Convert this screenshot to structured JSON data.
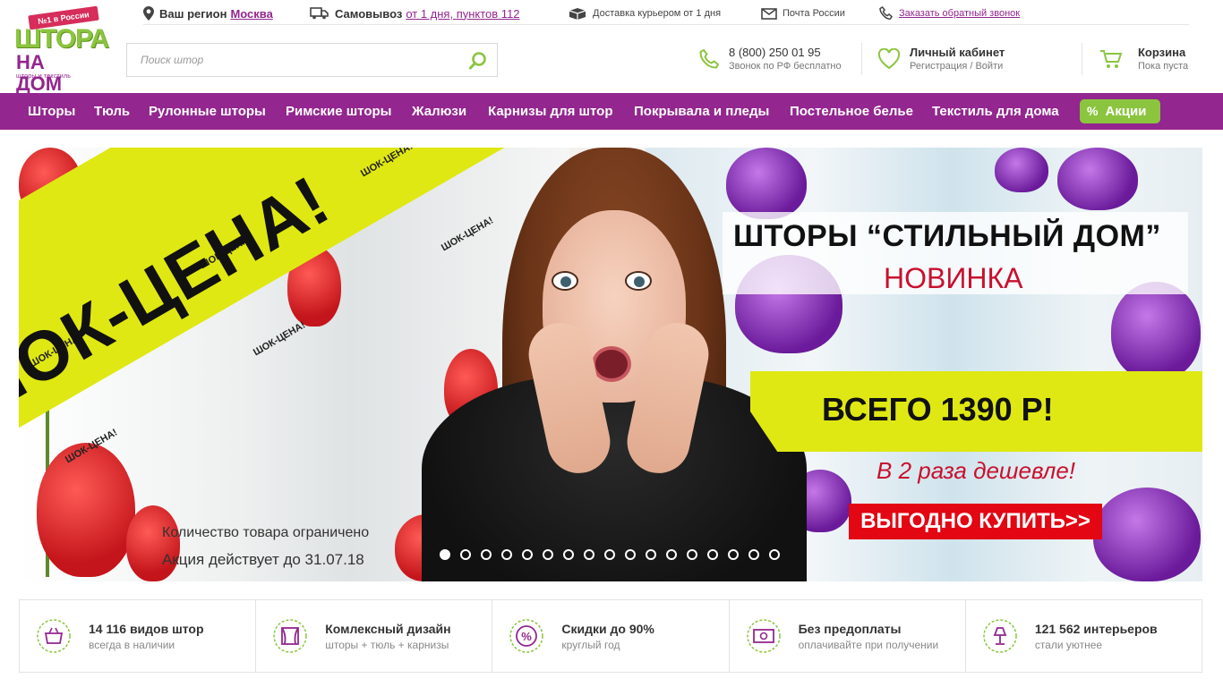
{
  "logo": {
    "badge": "№1 в России",
    "line1": "ШТОРА",
    "line2": "НА ДОМ",
    "tagline": "шторы и текстиль"
  },
  "topbar": {
    "region_label": "Ваш регион",
    "region_value": "Москва",
    "pickup_label": "Самовывоз",
    "pickup_value": "от 1 дня, пунктов 112",
    "courier": "Доставка курьером от 1 дня",
    "post": "Почта России",
    "callback": "Заказать обратный звонок"
  },
  "search": {
    "placeholder": "Поиск штор"
  },
  "phone": {
    "number": "8 (800) 250 01 95",
    "note": "Звонок по РФ бесплатно"
  },
  "account": {
    "title": "Личный кабинет",
    "sub": "Регистрация / Войти"
  },
  "cart": {
    "title": "Корзина",
    "sub": "Пока пуста"
  },
  "nav": {
    "items": [
      "Шторы",
      "Тюль",
      "Рулонные шторы",
      "Римские шторы",
      "Жалюзи",
      "Карнизы для штор",
      "Покрывала и пледы",
      "Постельное белье",
      "Текстиль для дома"
    ],
    "promo_icon": "%",
    "promo": "Акции"
  },
  "banner": {
    "strip_big": "ШОК-ЦЕНА!",
    "strip_small": "ШОК-ЦЕНА!",
    "title": "ШТОРЫ “СТИЛЬНЫЙ ДОМ”",
    "subtitle": "НОВИНКА",
    "price": "ВСЕГО 1390 Р!",
    "cheaper": "В 2 раза дешевле!",
    "button": "ВЫГОДНО КУПИТЬ>>",
    "note1": "Количество товара ограничено",
    "note2": "Акция действует до 31.07.18",
    "slide_count": 17,
    "active_slide": 1
  },
  "features": [
    {
      "icon": "basket-icon",
      "title": "14 116 видов штор",
      "sub": "всегда в наличии"
    },
    {
      "icon": "curtain-window-icon",
      "title": "Комлексный дизайн",
      "sub": "шторы + тюль + карнизы"
    },
    {
      "icon": "percent-badge-icon",
      "title": "Скидки до 90%",
      "sub": "круглый год"
    },
    {
      "icon": "cash-icon",
      "title": "Без предоплаты",
      "sub": "оплачивайте при получении"
    },
    {
      "icon": "lamp-icon",
      "title": "121 562 интерьеров",
      "sub": "стали уютнее"
    }
  ],
  "colors": {
    "brand_purple": "#93268f",
    "brand_green": "#8bc53f",
    "accent_red": "#e30613",
    "banner_yellow": "#dfe812"
  }
}
